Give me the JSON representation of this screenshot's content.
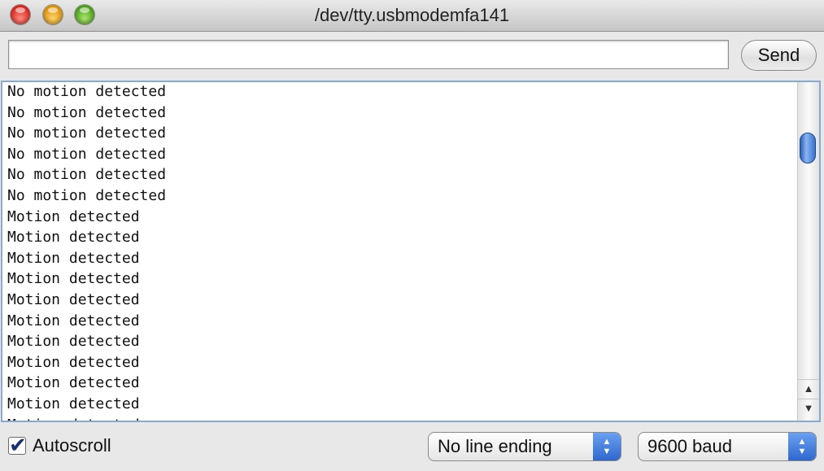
{
  "window": {
    "title": "/dev/tty.usbmodemfa141"
  },
  "input": {
    "value": "",
    "placeholder": ""
  },
  "send_button": {
    "label": "Send"
  },
  "console": {
    "lines": [
      "No motion detected",
      "No motion detected",
      "No motion detected",
      "No motion detected",
      "No motion detected",
      "No motion detected",
      "Motion detected",
      "Motion detected",
      "Motion detected",
      "Motion detected",
      "Motion detected",
      "Motion detected",
      "Motion detected",
      "Motion detected",
      "Motion detected",
      "Motion detected",
      "Motion detected"
    ]
  },
  "autoscroll": {
    "label": "Autoscroll",
    "checked": true
  },
  "line_ending": {
    "selected": "No line ending"
  },
  "baud": {
    "selected": "9600 baud"
  },
  "icons": {
    "up": "▲",
    "down": "▼"
  }
}
